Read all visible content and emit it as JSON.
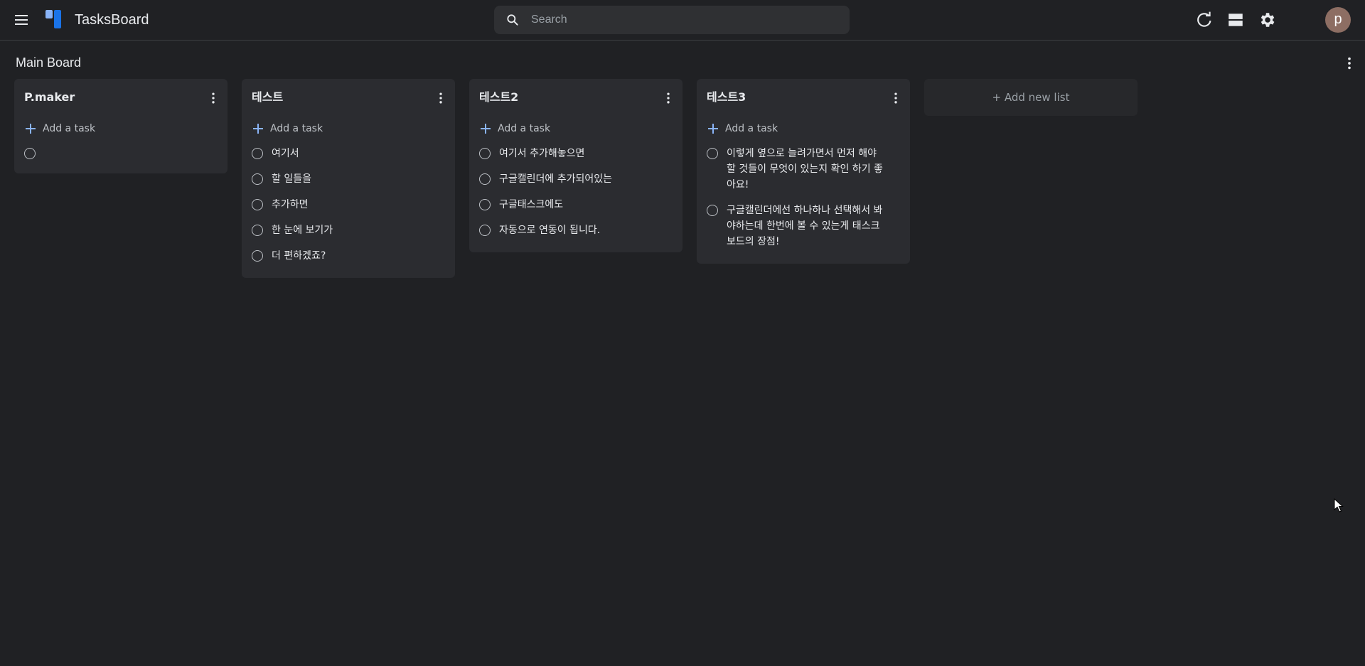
{
  "header": {
    "app_title": "TasksBoard",
    "search_placeholder": "Search",
    "avatar_letter": "p",
    "icons": [
      "menu-icon",
      "logo-icon",
      "search-icon",
      "refresh-icon",
      "view-toggle-icon",
      "settings-icon"
    ]
  },
  "board": {
    "title": "Main Board"
  },
  "add_task_label": "Add a task",
  "add_list_label": "+ Add new list",
  "lists": [
    {
      "title": "P.maker",
      "tasks": [
        ""
      ]
    },
    {
      "title": "테스트",
      "tasks": [
        "여기서",
        "할 일들을",
        "추가하면",
        "한 눈에 보기가",
        "더 편하겠죠?"
      ]
    },
    {
      "title": "테스트2",
      "tasks": [
        "여기서 추가해놓으면",
        "구글캘린더에 추가되어있는",
        "구글태스크에도",
        "자동으로 연동이 됩니다."
      ]
    },
    {
      "title": "테스트3",
      "tasks": [
        "이렇게 옆으로 늘려가면서 먼저 해야 할 것들이 무엇이 있는지 확인 하기 좋아요!",
        "구글캘린더에선 하나하나 선택해서 봐야하는데 한번에 볼 수 있는게 태스크보드의 장점!"
      ]
    }
  ],
  "colors": {
    "background": "#202124",
    "card": "#2b2c30",
    "accent": "#8ab4f8",
    "logo_blue": "#1a73e8",
    "avatar": "#8d6e63"
  }
}
